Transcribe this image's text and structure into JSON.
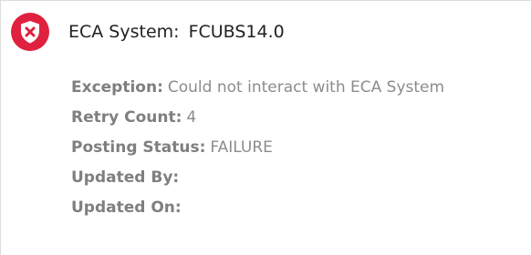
{
  "header": {
    "icon": "error-x-icon",
    "icon_color": "#e0203f",
    "system_label": "ECA System:",
    "system_value": "FCUBS14.0"
  },
  "details": {
    "exception": {
      "label": "Exception:",
      "value": "Could not interact with ECA System"
    },
    "retry_count": {
      "label": "Retry Count:",
      "value": "4"
    },
    "posting_status": {
      "label": "Posting Status:",
      "value": "FAILURE"
    },
    "updated_by": {
      "label": "Updated By:",
      "value": ""
    },
    "updated_on": {
      "label": "Updated On:",
      "value": ""
    }
  }
}
